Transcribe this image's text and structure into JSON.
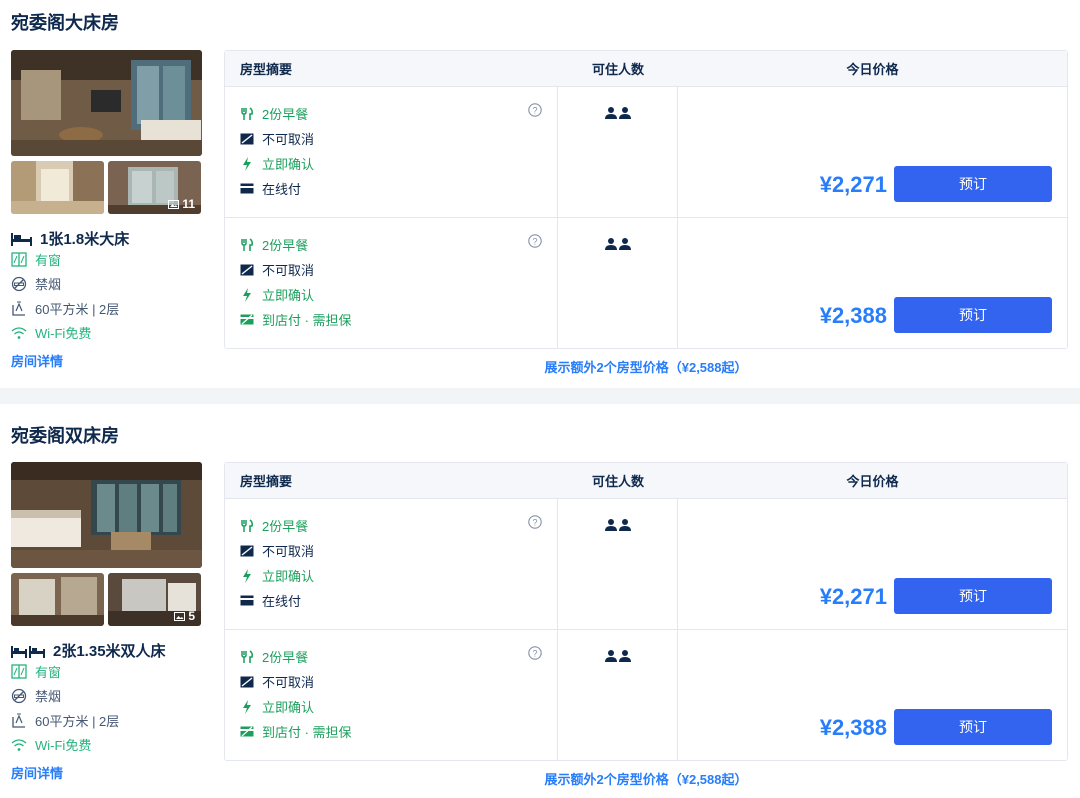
{
  "colors": {
    "accent": "#287dfa",
    "button": "#3264f0",
    "green": "#1c9f5d",
    "teal": "#06aebd"
  },
  "table_headers": {
    "summary": "房型摘要",
    "capacity": "可住人数",
    "price": "今日价格"
  },
  "rooms": [
    {
      "title": "宛委阁大床房",
      "photo_count": "11",
      "bed": "1张1.8米大床",
      "features": {
        "window": "有窗",
        "smoke": "禁烟",
        "area": "60平方米 | 2层",
        "wifi": "Wi-Fi免费"
      },
      "detail_link": "房间详情",
      "rates": [
        {
          "breakfast": "2份早餐",
          "cancel": "不可取消",
          "confirm": "立即确认",
          "payment": "在线付",
          "price": "¥2,271",
          "book": "预订"
        },
        {
          "breakfast": "2份早餐",
          "cancel": "不可取消",
          "confirm": "立即确认",
          "payment": "到店付 · 需担保",
          "price": "¥2,388",
          "book": "预订"
        }
      ],
      "more": "展示额外2个房型价格（¥2,588起）"
    },
    {
      "title": "宛委阁双床房",
      "photo_count": "5",
      "bed": "2张1.35米双人床",
      "features": {
        "window": "有窗",
        "smoke": "禁烟",
        "area": "60平方米 | 2层",
        "wifi": "Wi-Fi免费"
      },
      "detail_link": "房间详情",
      "rates": [
        {
          "breakfast": "2份早餐",
          "cancel": "不可取消",
          "confirm": "立即确认",
          "payment": "在线付",
          "price": "¥2,271",
          "book": "预订"
        },
        {
          "breakfast": "2份早餐",
          "cancel": "不可取消",
          "confirm": "立即确认",
          "payment": "到店付 · 需担保",
          "price": "¥2,388",
          "book": "预订"
        }
      ],
      "more": "展示额外2个房型价格（¥2,588起）"
    }
  ]
}
